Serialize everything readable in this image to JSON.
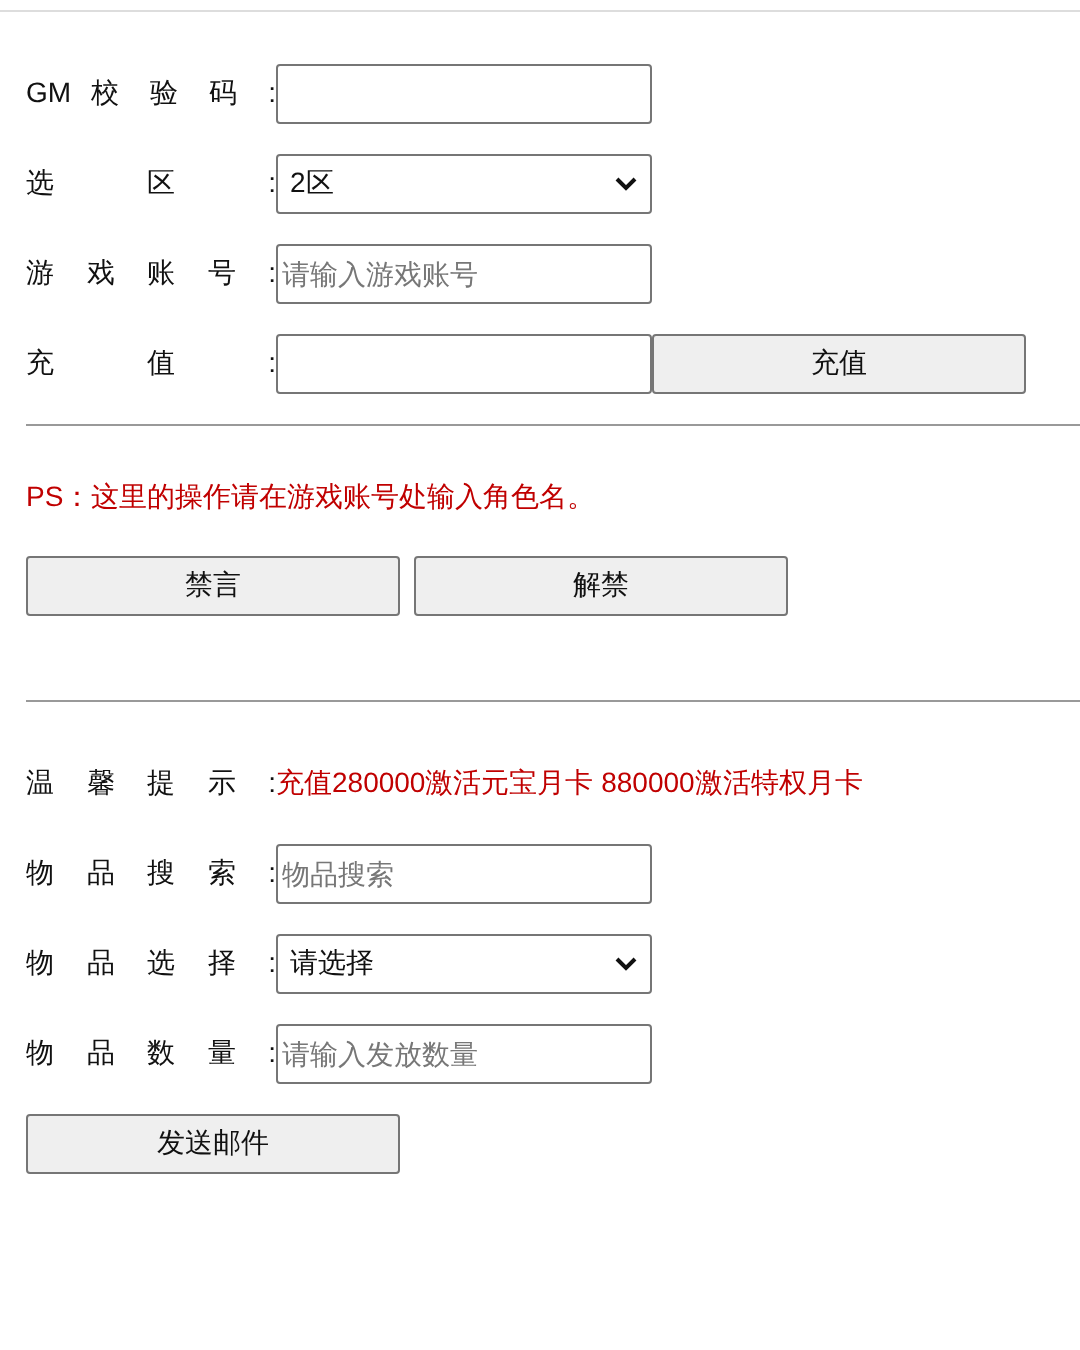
{
  "sections": [
    {
      "rows": [
        {
          "kind": "text",
          "label": "GM 校 验 码 :"
        },
        {
          "kind": "select",
          "label": "选 区 :",
          "value": "2区"
        },
        {
          "kind": "text",
          "label": "游 戏 账 号 :",
          "placeholder": "请输入游戏账号"
        },
        {
          "kind": "text-button",
          "label": "充 值 :",
          "button": "充值"
        }
      ]
    },
    {
      "note": "PS：这里的操作请在游戏账号处输入角色名。",
      "buttons": [
        "禁言",
        "解禁"
      ]
    },
    {
      "rows": [
        {
          "kind": "hint",
          "label": "温 馨 提 示 :",
          "text": "充值280000激活元宝月卡 880000激活特权月卡"
        },
        {
          "kind": "text",
          "label": "物 品 搜 索 :",
          "placeholder": "物品搜索"
        },
        {
          "kind": "select",
          "label": "物 品 选 择 :",
          "value": "请选择"
        },
        {
          "kind": "text",
          "label": "物 品 数 量 :",
          "placeholder": "请输入发放数量"
        }
      ],
      "buttons": [
        "发送邮件"
      ]
    }
  ]
}
